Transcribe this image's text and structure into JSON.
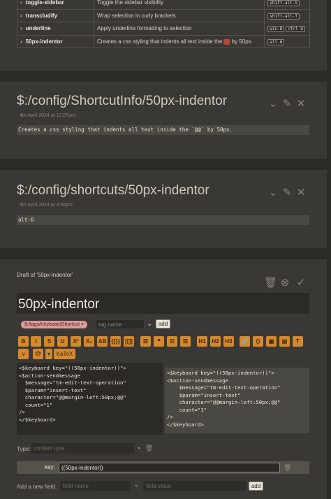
{
  "shortcut_table": {
    "rows": [
      {
        "name": "toggle-sidebar",
        "description": "Toggle the sidebar visibility",
        "keys": [
          "shift-alt-S"
        ]
      },
      {
        "name": "transcludify",
        "description": "Wrap selection in curly brackets",
        "keys": [
          "shift-alt-T"
        ]
      },
      {
        "name": "underline",
        "description": "Apply underline formatting to selection",
        "keys": [
          "win-U",
          "ctrl-U"
        ]
      },
      {
        "name": "50px-indentor",
        "description_pre": "Creates a css styling that indents all text inside the",
        "description_post": "by 50px.",
        "keys": [
          "alt-6"
        ]
      }
    ]
  },
  "tiddler_info": {
    "title": "$:/config/ShortcutInfo/50px-indentor",
    "subtitle": "4th April 2024 at 12:07pm",
    "body": "Creates a css styling that indents all text inside the `@@` by 50px."
  },
  "tiddler_shortcut": {
    "title": "$:/config/shortcuts/50px-indentor",
    "subtitle": "4th April 2024 at 3:56pm",
    "body": "alt-6"
  },
  "editor": {
    "draft_label": "Draft of '50px-indentor'",
    "title": "50px-indentor",
    "tag": "$:/tags/KeyboardShortcut ×",
    "tag_placeholder": "tag name",
    "add_label": "add",
    "toolbar_row1": [
      "B",
      "I",
      "S",
      "U",
      "X²",
      "X₂",
      "AB",
      "{{}}",
      "[[]]",
      "☰",
      "❝",
      "☷",
      "☰",
      "H1",
      "H2",
      "H3",
      "🔗",
      "⟨⟩",
      "▣",
      "▤",
      "T"
    ],
    "toolbar_row2": [
      "∨",
      "👁",
      "▾",
      "KaTeX"
    ],
    "source_lines": [
      "<$keyboard key=\"((50px-indentor))\">",
      "<$action-sendmessage",
      "  $message=\"tm-edit-text-operation\"",
      "  $param=\"insert-text\"",
      "  character=\"@@margin-left:50px;@@\"",
      "  count=\"1\"",
      "/>",
      "</$keyboard>"
    ],
    "preview_lines": [
      "<$keyboard key=\"((50px-indentor))\">",
      "<$action-sendmessage",
      "    $message=\"tm-edit-text-operation\"",
      "    $param=\"insert-text\"",
      "    character=\"@@margin-left:50px;@@\"",
      "    count=\"1\"",
      "/>",
      "</$keyboard>"
    ],
    "type_label": "Type:",
    "type_placeholder": "content type",
    "field_key_label": "key:",
    "field_key_value": "((50px-indentor))",
    "add_field_label": "Add a new field:",
    "field_name_placeholder": "field name",
    "field_value_placeholder": "field value",
    "add_field_button": "add"
  }
}
